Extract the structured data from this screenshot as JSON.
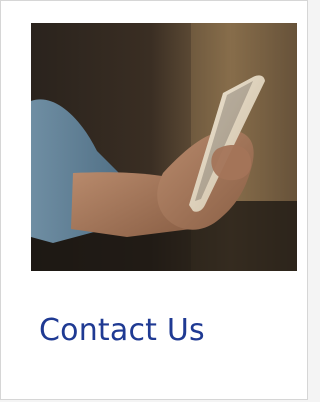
{
  "card": {
    "title": "Contact Us",
    "image_icon": "photo-hand-holding-phone",
    "title_color": "#1f3a93"
  }
}
